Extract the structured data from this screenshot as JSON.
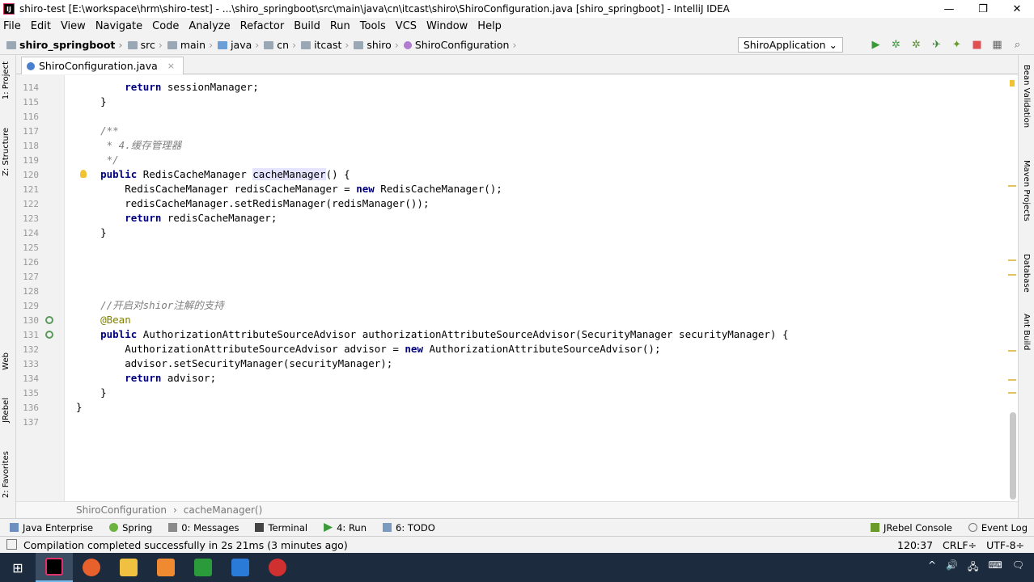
{
  "window": {
    "title": "shiro-test [E:\\workspace\\hrm\\shiro-test] - ...\\shiro_springboot\\src\\main\\java\\cn\\itcast\\shiro\\ShiroConfiguration.java [shiro_springboot] - IntelliJ IDEA",
    "app_icon": "IJ",
    "minimize": "—",
    "restore": "❐",
    "close": "✕"
  },
  "menu": [
    "File",
    "Edit",
    "View",
    "Navigate",
    "Code",
    "Analyze",
    "Refactor",
    "Build",
    "Run",
    "Tools",
    "VCS",
    "Window",
    "Help"
  ],
  "nav": {
    "items": [
      "shiro_springboot",
      "src",
      "main",
      "java",
      "cn",
      "itcast",
      "shiro",
      "ShiroConfiguration"
    ],
    "run_config": "ShiroApplication ⌄"
  },
  "toolbar_icons": [
    "run-icon",
    "debug-icon",
    "coverage-icon",
    "build-icon",
    "jrebel-icon",
    "stop-icon",
    "project-structure-icon",
    "search-icon"
  ],
  "left_tabs": [
    "1: Project",
    "Z: Structure",
    "Web",
    "JRebel",
    "2: Favorites"
  ],
  "right_tabs": [
    "Bean Validation",
    "Maven Projects",
    "Database",
    "Ant Build"
  ],
  "editor": {
    "tab": "ShiroConfiguration.java",
    "tab_close": "×",
    "lines": [
      {
        "n": "114",
        "code": "        return sessionManager;"
      },
      {
        "n": "115",
        "code": "    }"
      },
      {
        "n": "116",
        "code": ""
      },
      {
        "n": "117",
        "code": "    /**"
      },
      {
        "n": "118",
        "code": "     * 4.缓存管理器"
      },
      {
        "n": "119",
        "code": "     */"
      },
      {
        "n": "120",
        "code": "    public RedisCacheManager cacheManager() {"
      },
      {
        "n": "121",
        "code": "        RedisCacheManager redisCacheManager = new RedisCacheManager();"
      },
      {
        "n": "122",
        "code": "        redisCacheManager.setRedisManager(redisManager());"
      },
      {
        "n": "123",
        "code": "        return redisCacheManager;"
      },
      {
        "n": "124",
        "code": "    }"
      },
      {
        "n": "125",
        "code": ""
      },
      {
        "n": "126",
        "code": ""
      },
      {
        "n": "127",
        "code": ""
      },
      {
        "n": "128",
        "code": ""
      },
      {
        "n": "129",
        "code": "    //开启对shior注解的支持"
      },
      {
        "n": "130",
        "code": "    @Bean"
      },
      {
        "n": "131",
        "code": "    public AuthorizationAttributeSourceAdvisor authorizationAttributeSourceAdvisor(SecurityManager securityManager) {"
      },
      {
        "n": "132",
        "code": "        AuthorizationAttributeSourceAdvisor advisor = new AuthorizationAttributeSourceAdvisor();"
      },
      {
        "n": "133",
        "code": "        advisor.setSecurityManager(securityManager);"
      },
      {
        "n": "134",
        "code": "        return advisor;"
      },
      {
        "n": "135",
        "code": "    }"
      },
      {
        "n": "136",
        "code": "}"
      },
      {
        "n": "137",
        "code": ""
      }
    ],
    "breadcrumb": [
      "ShiroConfiguration",
      "cacheManager()"
    ]
  },
  "tool_windows": {
    "left": [
      "Java Enterprise",
      "Spring",
      "0: Messages",
      "Terminal",
      "4: Run",
      "6: TODO"
    ],
    "right": [
      "JRebel Console",
      "Event Log"
    ]
  },
  "status": {
    "message": "Compilation completed successfully in 2s 21ms (3 minutes ago)",
    "position": "120:37",
    "line_sep": "CRLF÷",
    "encoding": "UTF-8÷"
  },
  "taskbar": {
    "start": "⊞",
    "tray": [
      "^",
      "🔊",
      "🖧",
      "⌨",
      "🗨"
    ]
  }
}
